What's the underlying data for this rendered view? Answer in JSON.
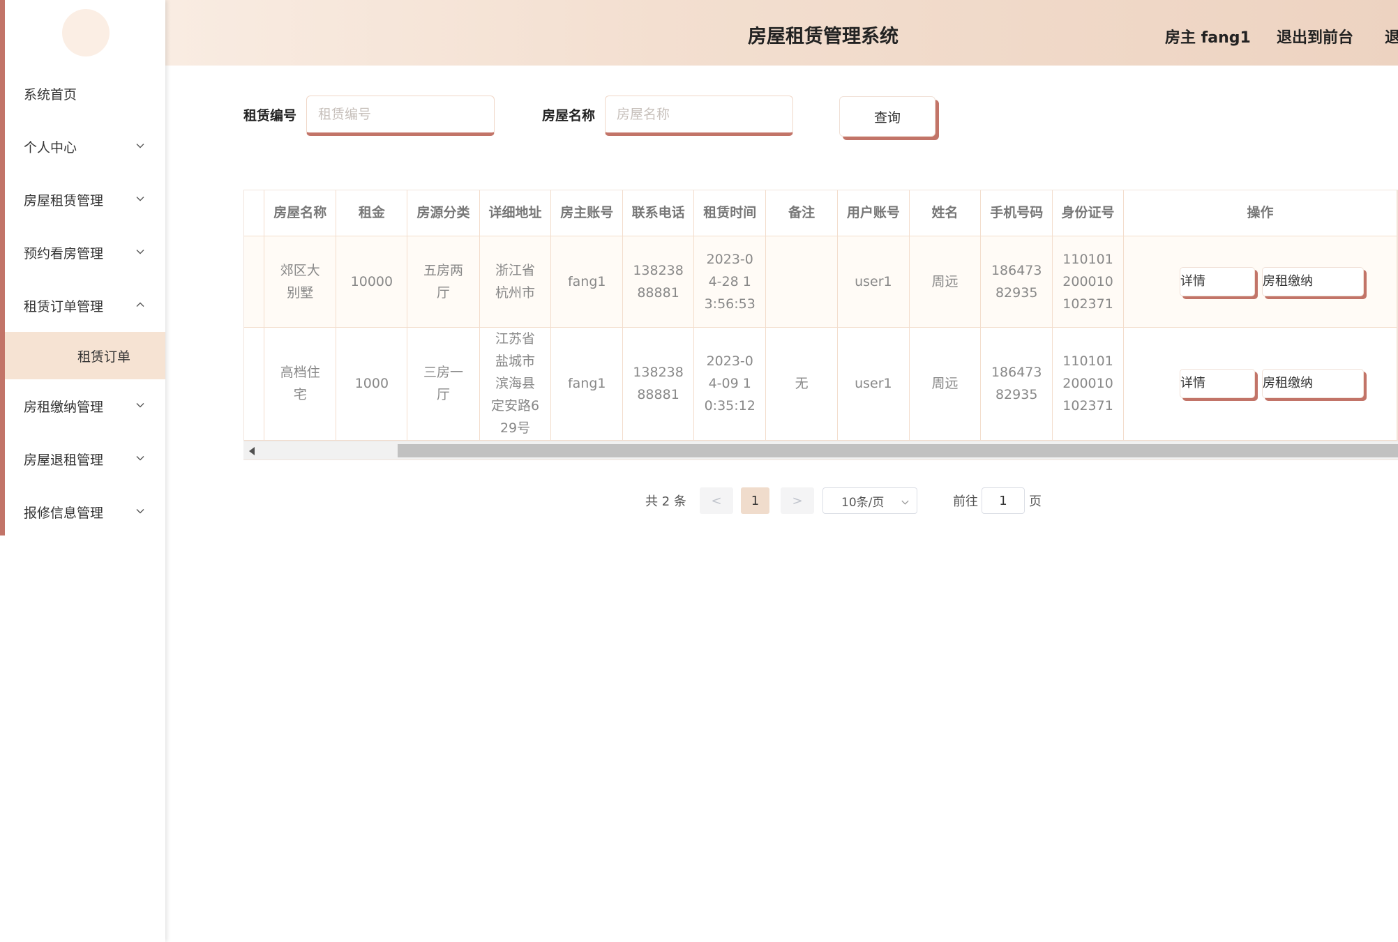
{
  "header": {
    "title": "房屋租赁管理系统",
    "user": "房主 fang1",
    "front_link": "退出到前台",
    "exit_link": "退出登录"
  },
  "sidebar": {
    "items": [
      {
        "label": "系统首页"
      },
      {
        "label": "个人中心",
        "icon": "chevron-down-icon"
      },
      {
        "label": "房屋租赁管理",
        "icon": "chevron-down-icon"
      },
      {
        "label": "预约看房管理",
        "icon": "chevron-down-icon"
      },
      {
        "label": "租赁订单管理",
        "icon": "chevron-up-icon",
        "expanded": true,
        "children": [
          {
            "label": "租赁订单",
            "active": true
          }
        ]
      },
      {
        "label": "房租缴纳管理",
        "icon": "chevron-down-icon"
      },
      {
        "label": "房屋退租管理",
        "icon": "chevron-down-icon"
      },
      {
        "label": "报修信息管理",
        "icon": "chevron-down-icon"
      }
    ]
  },
  "search": {
    "field1_label": "租赁编号",
    "field1_placeholder": "租赁编号",
    "field2_label": "房屋名称",
    "field2_placeholder": "房屋名称",
    "query_button": "查询"
  },
  "table": {
    "columns": [
      "房屋名称",
      "租金",
      "房源分类",
      "详细地址",
      "房主账号",
      "联系电话",
      "租赁时间",
      "备注",
      "用户账号",
      "姓名",
      "手机号码",
      "身份证号",
      "操作"
    ],
    "rows": [
      {
        "house_name": "郊区大别墅",
        "rent": "10000",
        "category": "五房两厅",
        "address": "浙江省杭州市",
        "owner_account": "fang1",
        "owner_phone": "13823888881",
        "lease_time": "2023-04-28 13:56:53",
        "remark": "",
        "user_account": "user1",
        "name": "周远",
        "mobile": "18647382935",
        "id_card": "110101200010102371",
        "detail_button": "详情",
        "pay_button": "房租缴纳"
      },
      {
        "house_name": "高档住宅",
        "rent": "1000",
        "category": "三房一厅",
        "address": "江苏省盐城市滨海县定安路629号",
        "owner_account": "fang1",
        "owner_phone": "13823888881",
        "lease_time": "2023-04-09 10:35:12",
        "remark": "无",
        "user_account": "user1",
        "name": "周远",
        "mobile": "18647382935",
        "id_card": "110101200010102371",
        "detail_button": "详情",
        "pay_button": "房租缴纳"
      }
    ]
  },
  "pagination": {
    "total": "共 2 条",
    "prev": "<",
    "current": "1",
    "next": ">",
    "page_size": "10条/页",
    "goto_label": "前往",
    "goto_value": "1",
    "page_suffix": "页"
  },
  "colors": {
    "accent": "#c27468",
    "header_gradient_start": "#f9ece2",
    "header_gradient_end": "#edd3c1",
    "active_menu_bg": "#f6e3d3"
  }
}
